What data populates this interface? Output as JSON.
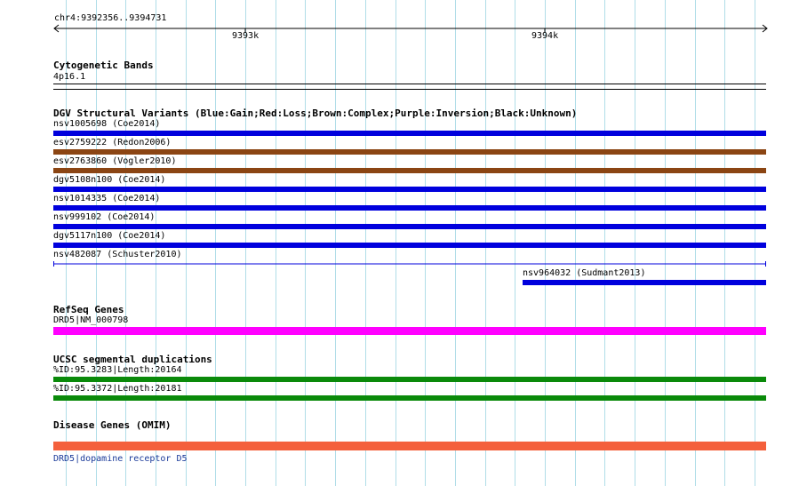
{
  "ruler": {
    "location": "chr4:9392356..9394731",
    "ticks": [
      {
        "label": "9393k"
      },
      {
        "label": "9394k"
      }
    ]
  },
  "cytobands": {
    "title": "Cytogenetic Bands",
    "band": "4p16.1"
  },
  "dgv": {
    "title": "DGV Structural Variants (Blue:Gain;Red:Loss;Brown:Complex;Purple:Inversion;Black:Unknown)",
    "colors": {
      "gain": "#0000dd",
      "complex": "#8b4513",
      "thin": "#0000dd"
    },
    "variants": [
      {
        "label": "nsv1005698 (Coe2014)",
        "type": "gain"
      },
      {
        "label": "esv2759222 (Redon2006)",
        "type": "complex"
      },
      {
        "label": "esv2763860 (Vogler2010)",
        "type": "complex"
      },
      {
        "label": "dgv5108n100 (Coe2014)",
        "type": "gain"
      },
      {
        "label": "nsv1014335 (Coe2014)",
        "type": "gain"
      },
      {
        "label": "nsv999102 (Coe2014)",
        "type": "gain"
      },
      {
        "label": "dgv5117n100 (Coe2014)",
        "type": "gain"
      },
      {
        "label": "nsv482087 (Schuster2010)",
        "type": "thin"
      },
      {
        "label": "nsv964032 (Sudmant2013)",
        "type": "gain"
      }
    ]
  },
  "refseq": {
    "title": "RefSeq Genes",
    "gene": "DRD5|NM_000798",
    "color": "#ff00ff"
  },
  "segdups": {
    "title": "UCSC segmental duplications",
    "color": "#0a8a0a",
    "items": [
      {
        "label": "%ID:95.3283|Length:20164"
      },
      {
        "label": "%ID:95.3372|Length:20181"
      }
    ]
  },
  "omim": {
    "title": "Disease Genes (OMIM)",
    "color": "#f4603c",
    "gene_label": "DRD5|dopamine receptor D5",
    "label_color": "#1a3a9a"
  },
  "colors": {
    "grid": "#b0dde8"
  }
}
